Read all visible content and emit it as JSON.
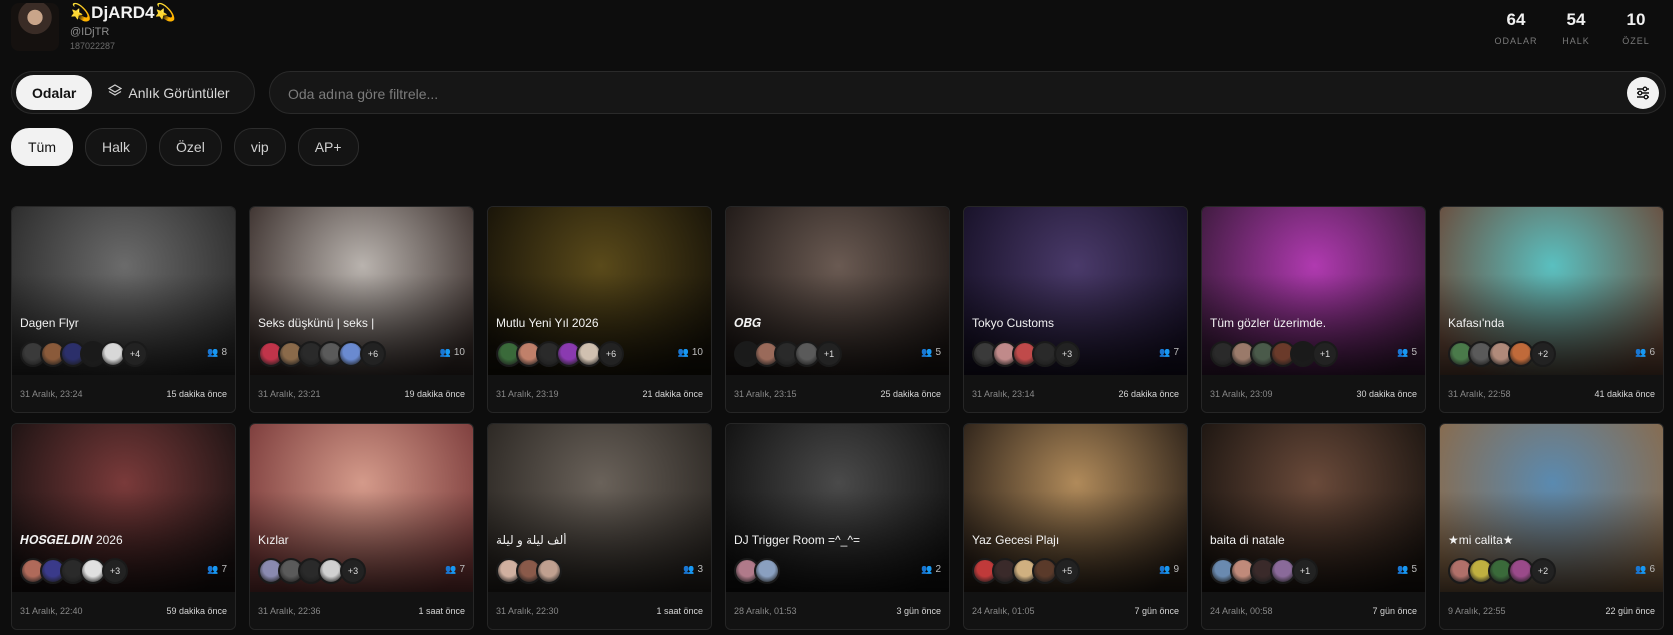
{
  "profile": {
    "name": "💫DjARD4💫",
    "handle": "@IDjTR",
    "uid": "187022287"
  },
  "stats": [
    {
      "value": "64",
      "label": "ODALAR"
    },
    {
      "value": "54",
      "label": "HALK"
    },
    {
      "value": "10",
      "label": "ÖZEL"
    }
  ],
  "tabs": {
    "rooms": "Odalar",
    "snapshots": "Anlık Görüntüler"
  },
  "search": {
    "placeholder": "Oda adına göre filtrele..."
  },
  "chips": [
    "Tüm",
    "Halk",
    "Özel",
    "vip",
    "AP+"
  ],
  "rooms": [
    {
      "title": "Dagen Flyr",
      "more": "+4",
      "count": "8",
      "date": "31 Aralık, 23:24",
      "ago": "15 dakika önce",
      "bg": [
        "#6b6b6b",
        "#2a2a2a"
      ],
      "avatars": [
        "#3a3a3a",
        "#8a5a3a",
        "#2b2f6a",
        "#1a1a1a",
        "#d8d8d8"
      ]
    },
    {
      "title": "Seks düşkünü | seks |",
      "more": "+6",
      "count": "10",
      "date": "31 Aralık, 23:21",
      "ago": "19 dakika önce",
      "bg": [
        "#b9b3ae",
        "#3a2f2c"
      ],
      "avatars": [
        "#c0344a",
        "#8a6a4a",
        "#2a2a2a",
        "#5a5a5a",
        "#6a8ad0"
      ]
    },
    {
      "title": "Mutlu Yeni Yıl 2026",
      "more": "+6",
      "count": "10",
      "date": "31 Aralık, 23:19",
      "ago": "21 dakika önce",
      "bg": [
        "#5a4a1a",
        "#161208"
      ],
      "avatars": [
        "#3a6a3a",
        "#c0806a",
        "#2a2a2a",
        "#8a3ab0",
        "#d0c0b0"
      ]
    },
    {
      "title": "𝑶𝑩𝑮",
      "more": "+1",
      "count": "5",
      "date": "31 Aralık, 23:15",
      "ago": "25 dakika önce",
      "bg": [
        "#6a5a52",
        "#1e1816"
      ],
      "avatars": [
        "#1a1a1a",
        "#9a6a5a",
        "#2a2a2a",
        "#5a5a5a"
      ]
    },
    {
      "title": "Tokyo Customs",
      "more": "+3",
      "count": "7",
      "date": "31 Aralık, 23:14",
      "ago": "26 dakika önce",
      "bg": [
        "#4a3a6a",
        "#161026"
      ],
      "avatars": [
        "#3a3a3a",
        "#c08a8a",
        "#c04a4a",
        "#2a2a2a"
      ]
    },
    {
      "title": "Tüm gözler üzerimde.",
      "more": "+1",
      "count": "5",
      "date": "31 Aralık, 23:09",
      "ago": "30 dakika önce",
      "bg": [
        "#b03ab0",
        "#3a1a3a"
      ],
      "avatars": [
        "#2a2a2a",
        "#9a7a6a",
        "#4a5a4a",
        "#6a3a2a",
        "#1a1a1a"
      ]
    },
    {
      "title": "Kafası'nda",
      "more": "+2",
      "count": "6",
      "date": "31 Aralık, 22:58",
      "ago": "41 dakika önce",
      "bg": [
        "#5ac0c0",
        "#6a4a3a"
      ],
      "avatars": [
        "#4a7a4a",
        "#5a5a5a",
        "#b08a7a",
        "#c06a3a"
      ]
    },
    {
      "title": "𝑯𝑶𝑺𝑮𝑬𝑳𝑫𝑰𝑵 2026",
      "more": "+3",
      "count": "7",
      "date": "31 Aralık, 22:40",
      "ago": "59 dakika önce",
      "bg": [
        "#7a3a3a",
        "#1a1212"
      ],
      "avatars": [
        "#b06a5a",
        "#3a3a8a",
        "#2a2a2a",
        "#e0e0e0"
      ]
    },
    {
      "title": "Kızlar",
      "more": "+3",
      "count": "7",
      "date": "31 Aralık, 22:36",
      "ago": "1 saat önce",
      "bg": [
        "#d49a8a",
        "#7a3a3a"
      ],
      "avatars": [
        "#8a8ab0",
        "#5a5a5a",
        "#2a2a2a",
        "#d0d0d0"
      ]
    },
    {
      "title": "ألف ليلة و ليلة",
      "more": "",
      "count": "3",
      "date": "31 Aralık, 22:30",
      "ago": "1 saat önce",
      "bg": [
        "#6a625a",
        "#2a2622"
      ],
      "avatars": [
        "#d0b0a0",
        "#8a5a4a",
        "#c0a090"
      ]
    },
    {
      "title": "DJ Trigger Room =^_^=",
      "more": "",
      "count": "2",
      "date": "28 Aralık, 01:53",
      "ago": "3 gün önce",
      "bg": [
        "#4a4a4a",
        "#101010"
      ],
      "avatars": [
        "#b07a8a",
        "#8aa0c0"
      ]
    },
    {
      "title": "Yaz Gecesi Plajı",
      "more": "+5",
      "count": "9",
      "date": "24 Aralık, 01:05",
      "ago": "7 gün önce",
      "bg": [
        "#b08a5a",
        "#2a2018"
      ],
      "avatars": [
        "#c03a3a",
        "#3a2a2a",
        "#d0b080",
        "#5a3a2a"
      ]
    },
    {
      "title": "baita di natale",
      "more": "+1",
      "count": "5",
      "date": "24 Aralık, 00:58",
      "ago": "7 gün önce",
      "bg": [
        "#6a4a3a",
        "#1a1410"
      ],
      "avatars": [
        "#6a8ab0",
        "#c08a7a",
        "#3a2a2a",
        "#8a6a9a"
      ]
    },
    {
      "title": "★mi calita★",
      "more": "+2",
      "count": "6",
      "date": "9 Aralık, 22:55",
      "ago": "22 gün önce",
      "bg": [
        "#5a8ab0",
        "#8a6a4a"
      ],
      "avatars": [
        "#b0706a",
        "#c0b040",
        "#3a6a3a",
        "#9a4a8a"
      ]
    }
  ]
}
